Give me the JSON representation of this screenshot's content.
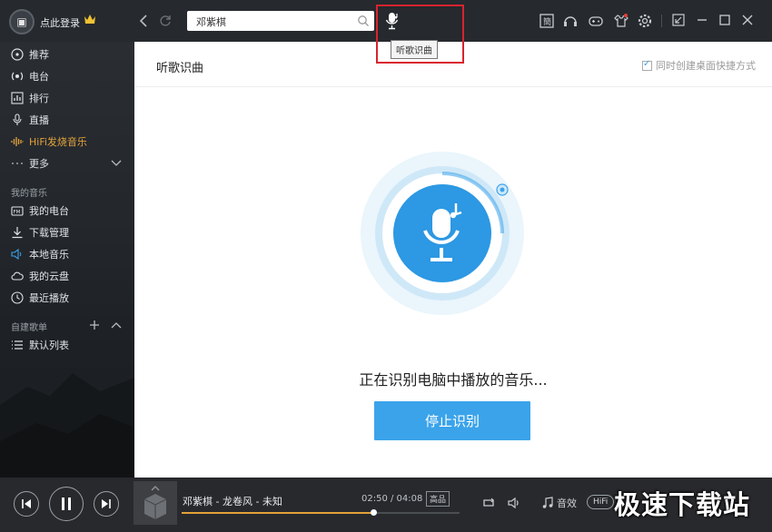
{
  "app": {
    "login_label": "点此登录",
    "search_value": "邓紫棋",
    "tooltip": "听歌识曲"
  },
  "sidebar": {
    "items": [
      {
        "label": "推荐",
        "icon": "disc-icon"
      },
      {
        "label": "电台",
        "icon": "radio-icon"
      },
      {
        "label": "排行",
        "icon": "chart-icon"
      },
      {
        "label": "直播",
        "icon": "mic-icon"
      },
      {
        "label": "HiFi发烧音乐",
        "icon": "waveform-icon"
      },
      {
        "label": "更多",
        "icon": "more-icon"
      }
    ],
    "my_music_title": "我的音乐",
    "my_music": [
      {
        "label": "我的电台",
        "icon": "fm-icon"
      },
      {
        "label": "下载管理",
        "icon": "download-icon"
      },
      {
        "label": "本地音乐",
        "icon": "speaker-icon"
      },
      {
        "label": "我的云盘",
        "icon": "cloud-icon"
      },
      {
        "label": "最近播放",
        "icon": "clock-icon"
      }
    ],
    "playlist_title": "自建歌单",
    "playlists": [
      {
        "label": "默认列表",
        "icon": "list-icon"
      }
    ]
  },
  "main": {
    "title": "听歌识曲",
    "shortcut_label": "同时创建桌面快捷方式",
    "shortcut_checked": true,
    "status_text": "正在识别电脑中播放的音乐...",
    "stop_button": "停止识别"
  },
  "player": {
    "song": "邓紫棋 - 龙卷风 - 未知",
    "time": "02:50 / 04:08",
    "quality": "高品",
    "effect_label": "音效",
    "hifi_label": "HiFi",
    "progress": 0.69
  },
  "watermark": "极速下载站",
  "colors": {
    "accent": "#3aa3ea",
    "active_nav": "#e3a23a",
    "highlight_box": "#d9232f"
  }
}
